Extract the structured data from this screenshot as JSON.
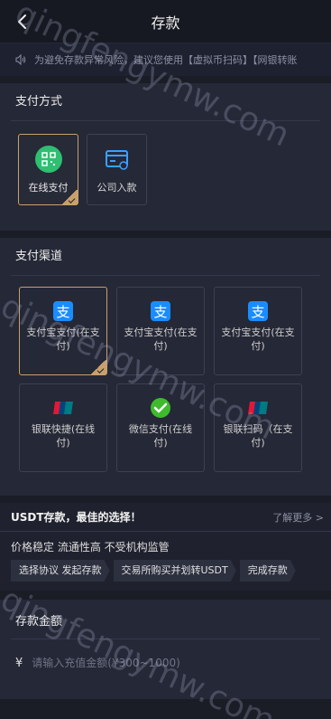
{
  "header": {
    "title": "存款"
  },
  "notice": {
    "text": "为避免存款异常风险，建议您使用【虚拟币扫码】【网银转账"
  },
  "payment_method": {
    "title": "支付方式",
    "items": [
      {
        "label": "在线支付",
        "icon": "qr-scan-icon",
        "active": true
      },
      {
        "label": "公司入款",
        "icon": "bank-card-icon",
        "active": false
      }
    ]
  },
  "channels": {
    "title": "支付渠道",
    "items": [
      {
        "label": "支付宝支付(在支付)",
        "icon": "alipay-icon",
        "active": true
      },
      {
        "label": "支付宝支付(在支付)",
        "icon": "alipay-icon",
        "active": false
      },
      {
        "label": "支付宝支付(在支付)",
        "icon": "alipay-icon",
        "active": false
      },
      {
        "label": "银联快捷(在线付)",
        "icon": "unionpay-icon",
        "active": false
      },
      {
        "label": "微信支付(在线付)",
        "icon": "wechat-pay-icon",
        "active": false
      },
      {
        "label": "银联扫码（在支付)",
        "icon": "unionpay-icon",
        "active": false
      }
    ]
  },
  "usdt": {
    "title": "USDT存款，最佳的选择！",
    "more": "了解更多 >",
    "subtitle": "价格稳定 流通性高 不受机构监管",
    "steps": [
      "选择协议 发起存款",
      "交易所购买并划转USDT",
      "完成存款"
    ]
  },
  "amount": {
    "title": "存款金额",
    "currency": "¥",
    "placeholder": "请输入充值金额(¥300~1000)"
  },
  "watermark": {
    "text": "qingfengymw.com"
  },
  "colors": {
    "accent": "#c8a06e",
    "background": "#1a1d26",
    "panel": "#252836"
  }
}
